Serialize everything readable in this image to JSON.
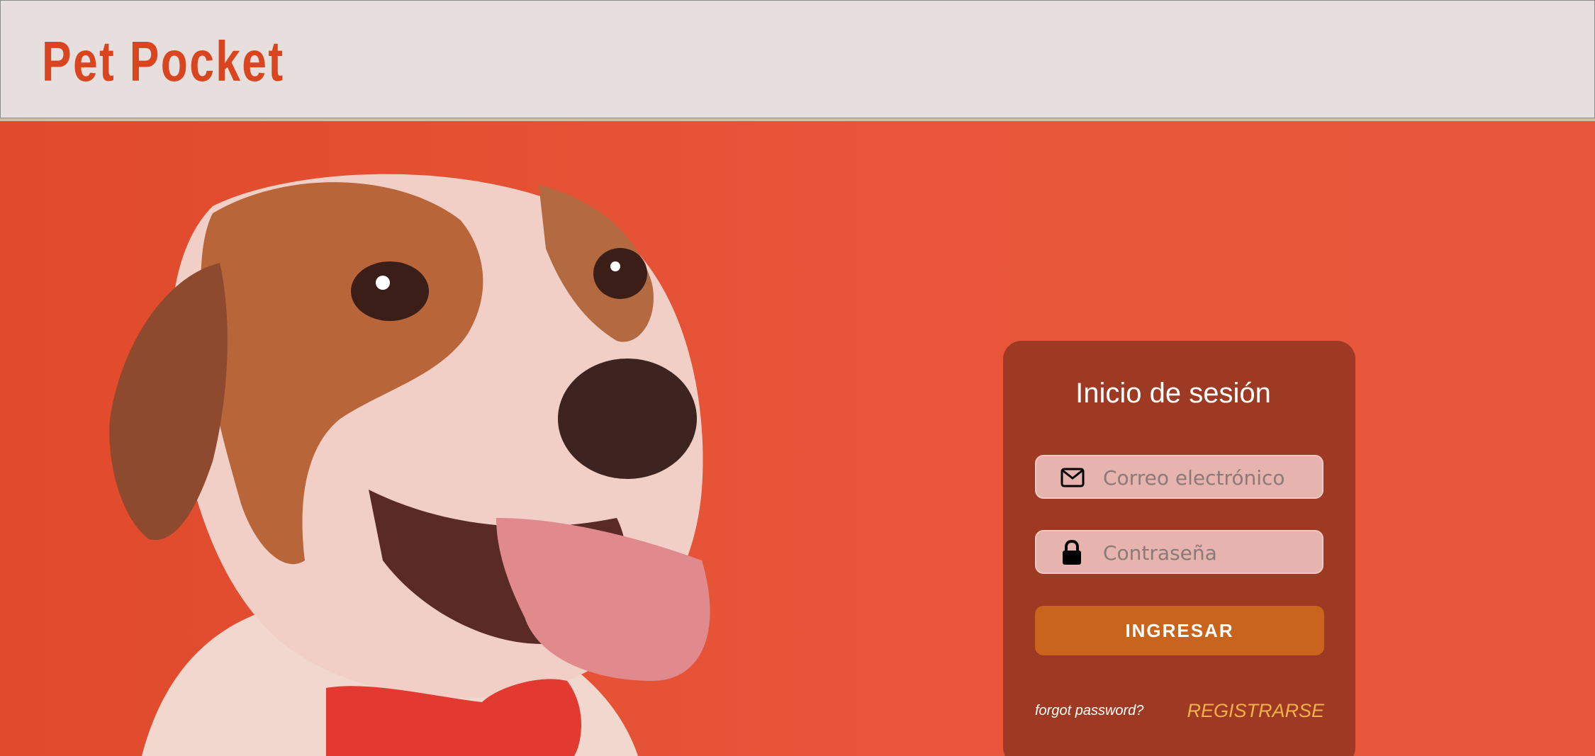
{
  "header": {
    "logo": "Pet Pocket"
  },
  "login": {
    "title": "Inicio de sesión",
    "email_placeholder": "Correo electrónico",
    "password_placeholder": "Contraseña",
    "submit_label": "INGRESAR",
    "forgot_label": "forgot password?",
    "register_label": "REGISTRARSE"
  },
  "icons": {
    "email": "envelope-icon",
    "password": "lock-icon"
  },
  "colors": {
    "brand": "#d9451f",
    "hero_bg": "#e4532f",
    "card_bg": "#9e3a23",
    "button": "#c8641c",
    "register_link": "#f2b04a"
  }
}
